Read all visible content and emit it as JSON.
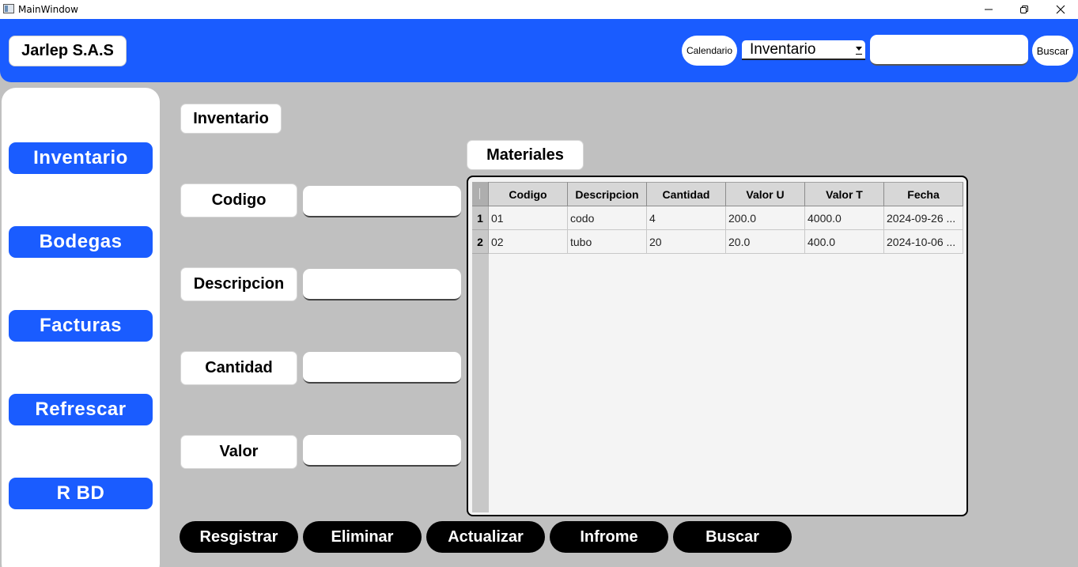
{
  "window": {
    "title": "MainWindow"
  },
  "header": {
    "brand": "Jarlep S.A.S",
    "calendar_label": "Calendario",
    "combo_value": "Inventario",
    "search_value": "",
    "search_label": "Buscar",
    "color": "#1a5cff"
  },
  "sidebar": {
    "items": [
      {
        "label": "Inventario"
      },
      {
        "label": "Bodegas"
      },
      {
        "label": "Facturas"
      },
      {
        "label": "Refrescar"
      },
      {
        "label": "R BD"
      }
    ]
  },
  "form": {
    "section_title": "Inventario",
    "fields": [
      {
        "label": "Codigo",
        "value": ""
      },
      {
        "label": "Descripcion",
        "value": ""
      },
      {
        "label": "Cantidad",
        "value": ""
      },
      {
        "label": "Valor",
        "value": ""
      }
    ]
  },
  "table": {
    "title": "Materiales",
    "columns": [
      "Codigo",
      "Descripcion",
      "Cantidad",
      "Valor U",
      "Valor T",
      "Fecha"
    ],
    "rows": [
      {
        "num": "1",
        "cells": [
          "01",
          "codo",
          "4",
          "200.0",
          "4000.0",
          "2024-09-26 ..."
        ]
      },
      {
        "num": "2",
        "cells": [
          "02",
          "tubo",
          "20",
          "20.0",
          "400.0",
          "2024-10-06 ..."
        ]
      }
    ]
  },
  "actions": [
    "Resgistrar",
    "Eliminar",
    "Actualizar",
    "Infrome",
    "Buscar"
  ]
}
